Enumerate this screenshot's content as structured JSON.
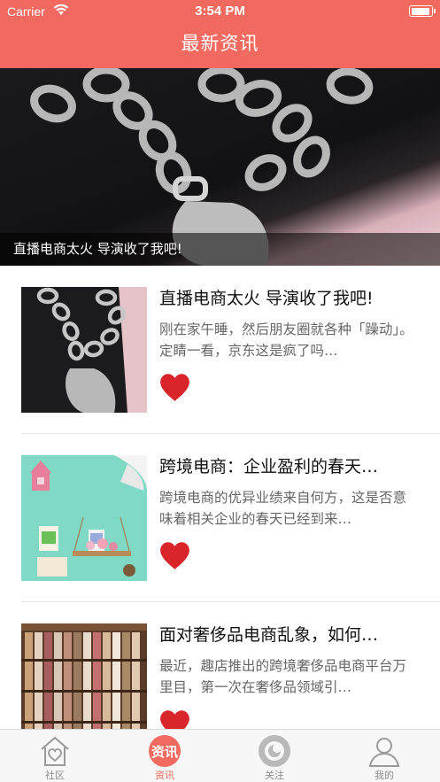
{
  "status_bar": {
    "carrier": "Carrier",
    "time": "3:54 PM"
  },
  "nav": {
    "title": "最新资讯"
  },
  "banner": {
    "caption": "直播电商太火 导演收了我吧!"
  },
  "news": [
    {
      "title": "直播电商太火 导演收了我吧!",
      "summary": "刚在家午睡，然后朋友圈就各种「躁动」。定睛一看，京东这是疯了吗…",
      "thumb": "bracelet-photo"
    },
    {
      "title": "跨境电商：企业盈利的春天…",
      "summary": "跨境电商的优异业绩来自何方，这是否意味着相关企业的春天已经到来…",
      "thumb": "shelf-decor-photo"
    },
    {
      "title": "面对奢侈品电商乱象，如何…",
      "summary": "最近，趣店推出的跨境奢侈品电商平台万里目，第一次在奢侈品领域引…",
      "thumb": "washi-tape-photo"
    }
  ],
  "tabs": [
    {
      "label": "社区",
      "icon": "home-heart-icon",
      "active": false
    },
    {
      "label": "资讯",
      "icon": "news-icon",
      "active": true,
      "badge_text": "资讯"
    },
    {
      "label": "关注",
      "icon": "follow-icon",
      "active": false
    },
    {
      "label": "我的",
      "icon": "profile-icon",
      "active": false
    }
  ],
  "colors": {
    "accent": "#f2695f",
    "heart": "#d9252a",
    "tab_inactive": "#8a8a8a"
  }
}
